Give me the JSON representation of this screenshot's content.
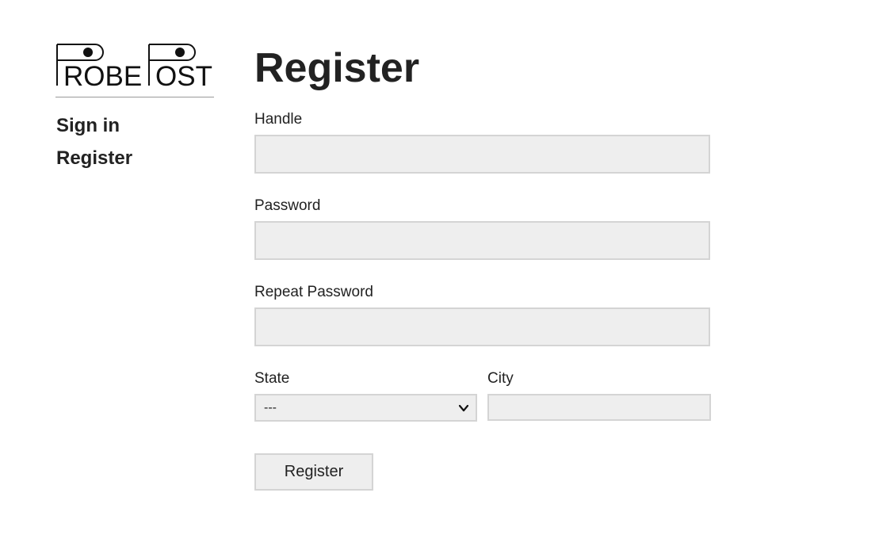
{
  "brand": {
    "logo_text": "PROBEPOST",
    "logo_icon": "probepost-logo"
  },
  "nav": {
    "items": [
      {
        "label": "Sign in"
      },
      {
        "label": "Register"
      }
    ]
  },
  "form": {
    "title": "Register",
    "handle_label": "Handle",
    "handle_value": "",
    "password_label": "Password",
    "password_value": "",
    "repeat_password_label": "Repeat Password",
    "repeat_password_value": "",
    "state_label": "State",
    "state_selected": "---",
    "state_icon": "chevron-down-icon",
    "city_label": "City",
    "city_value": "",
    "submit_label": "Register"
  },
  "colors": {
    "text": "#222222",
    "field_bg": "#eeeeee",
    "field_border": "#d4d4d4",
    "rule": "#999999"
  }
}
